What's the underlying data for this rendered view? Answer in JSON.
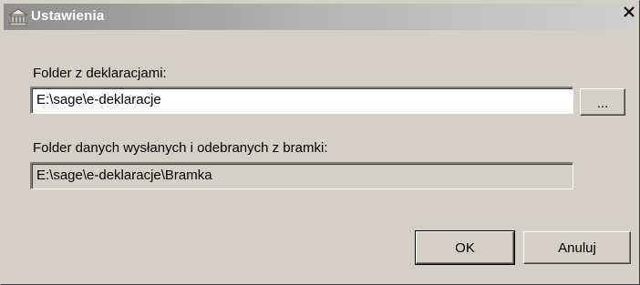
{
  "window": {
    "title": "Ustawienia",
    "icon": "settings-building-icon",
    "close_glyph": "✕"
  },
  "declarations_folder": {
    "label": "Folder z deklaracjami:",
    "value": "E:\\sage\\e-deklaracje",
    "browse_label": "..."
  },
  "gateway_folder": {
    "label": "Folder danych wysłanych i odebranych z bramki:",
    "value": "E:\\sage\\e-deklaracje\\Bramka"
  },
  "buttons": {
    "ok_label": "OK",
    "cancel_label": "Anuluj"
  },
  "colors": {
    "dialog_bg": "#d4d0c8",
    "titlebar_start": "#8e8e8e",
    "titlebar_end": "#d0d0d0"
  }
}
